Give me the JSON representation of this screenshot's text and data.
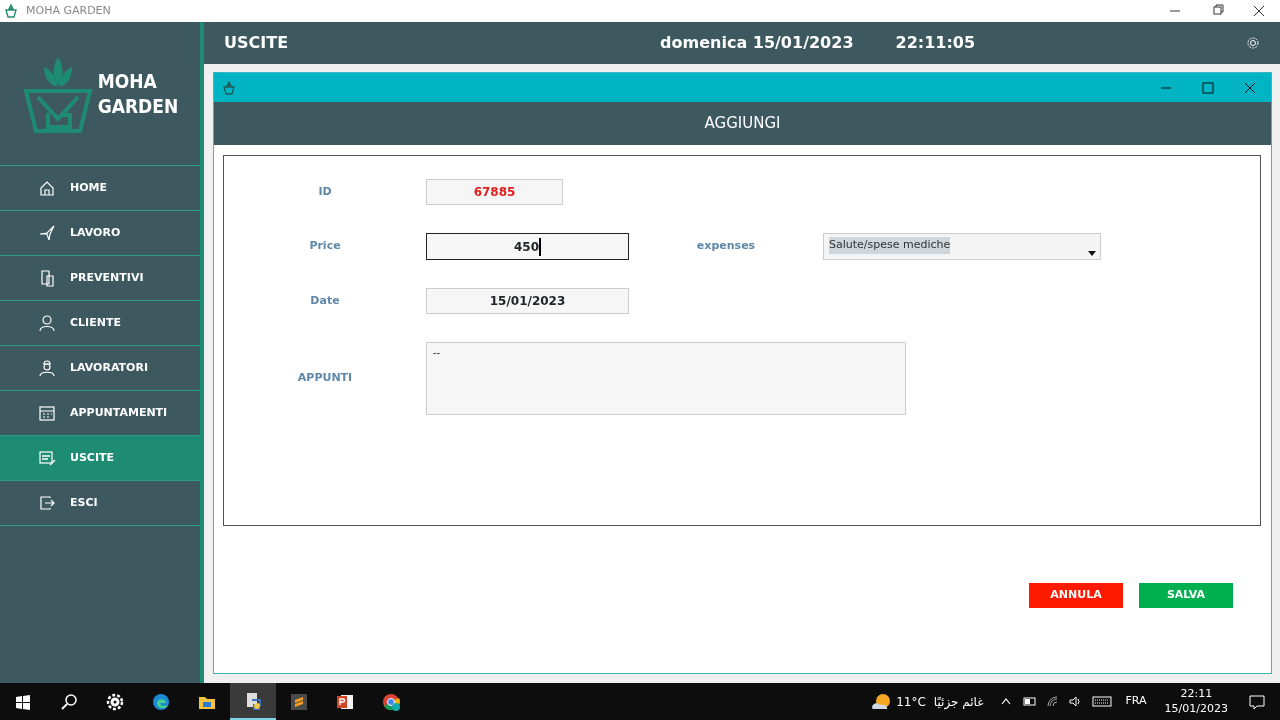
{
  "window": {
    "title": "MOHA GARDEN"
  },
  "logo": {
    "line_1": "MOHA",
    "line_2": "GARDEN"
  },
  "sidebar": {
    "items": [
      {
        "label": "HOME",
        "kind": "home",
        "selected": false
      },
      {
        "label": "LAVORO",
        "kind": "tool",
        "selected": false
      },
      {
        "label": "PREVENTIVI",
        "kind": "docs",
        "selected": false
      },
      {
        "label": "CLIENTE",
        "kind": "person",
        "selected": false
      },
      {
        "label": "LAVORATORI",
        "kind": "worker",
        "selected": false
      },
      {
        "label": "APPUNTAMENTI",
        "kind": "calendar",
        "selected": false
      },
      {
        "label": "USCITE",
        "kind": "form",
        "selected": true
      },
      {
        "label": "ESCI",
        "kind": "exit",
        "selected": false
      }
    ]
  },
  "header": {
    "title": "USCITE",
    "date": "domenica 15/01/2023",
    "time": "22:11:05"
  },
  "dialog": {
    "title": "AGGIUNGI",
    "id_field": {
      "label": "ID",
      "value": "67885"
    },
    "price_field": {
      "label": "Price",
      "value": "450",
      "focused": true
    },
    "expenses_field": {
      "label": "expenses",
      "value": "Salute/spese mediche"
    },
    "date_field": {
      "label": "Date",
      "value": "15/01/2023"
    },
    "notes_field": {
      "label": "APPUNTI",
      "value": "--"
    },
    "buttons": [
      {
        "label": "ANNULA",
        "kind": "cancel"
      },
      {
        "label": "SALVA",
        "kind": "save"
      }
    ]
  },
  "taskbar": {
    "apps": [
      {
        "kind": "start",
        "selected": false
      },
      {
        "kind": "search",
        "selected": false
      },
      {
        "kind": "settings",
        "selected": false
      },
      {
        "kind": "edge",
        "selected": false
      },
      {
        "kind": "folder",
        "selected": false
      },
      {
        "kind": "python",
        "selected": true
      },
      {
        "kind": "sublime",
        "selected": false
      },
      {
        "kind": "powerpoint",
        "selected": false
      },
      {
        "kind": "chrome",
        "selected": false
      }
    ],
    "weather": {
      "temperature": "11°C",
      "condition": "غائم جزئيًا"
    },
    "language": "FRA",
    "clock": {
      "time": "22:11",
      "date": "15/01/2023"
    }
  }
}
